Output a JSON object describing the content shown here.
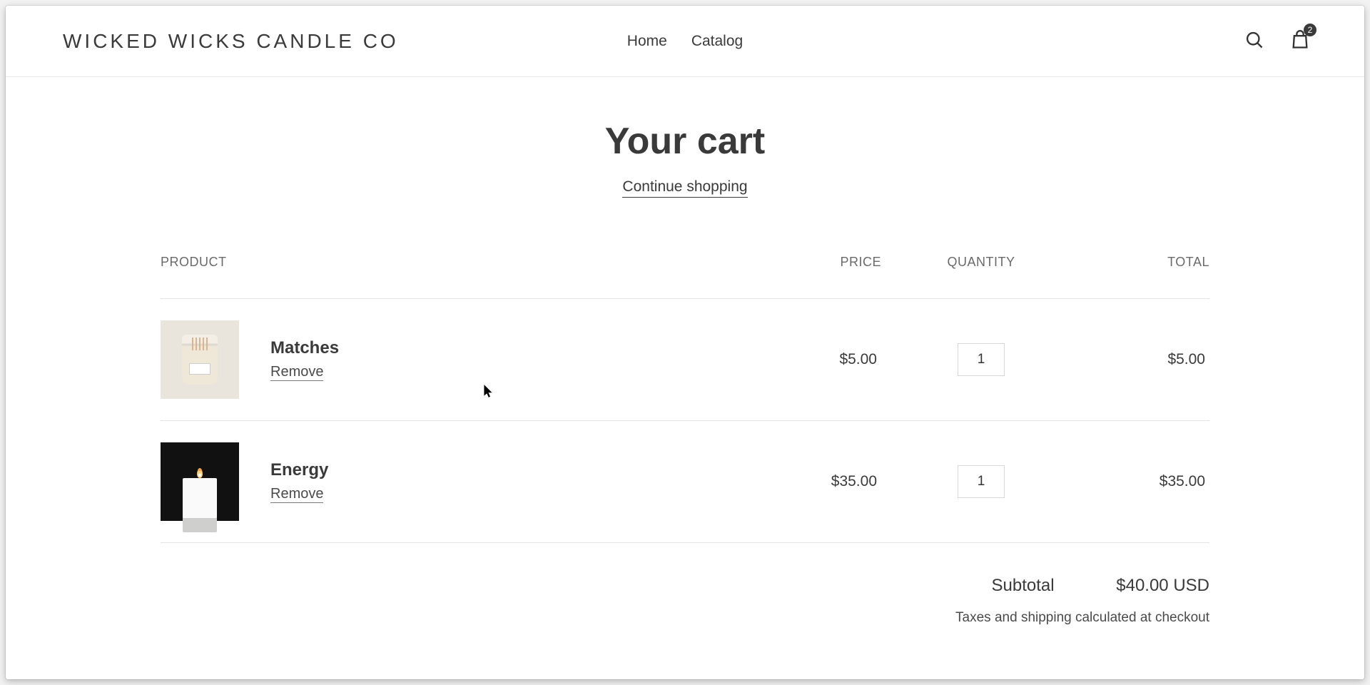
{
  "header": {
    "logo": "WICKED WICKS CANDLE CO",
    "nav": [
      "Home",
      "Catalog"
    ],
    "cart_count": "2"
  },
  "page": {
    "title": "Your cart",
    "continue": "Continue shopping"
  },
  "columns": {
    "product": "PRODUCT",
    "price": "PRICE",
    "quantity": "QUANTITY",
    "total": "TOTAL"
  },
  "items": [
    {
      "name": "Matches",
      "remove": "Remove",
      "price": "$5.00",
      "qty": "1",
      "total": "$5.00"
    },
    {
      "name": "Energy",
      "remove": "Remove",
      "price": "$35.00",
      "qty": "1",
      "total": "$35.00"
    }
  ],
  "summary": {
    "subtotal_label": "Subtotal",
    "subtotal_value": "$40.00 USD",
    "tax_note": "Taxes and shipping calculated at checkout"
  }
}
